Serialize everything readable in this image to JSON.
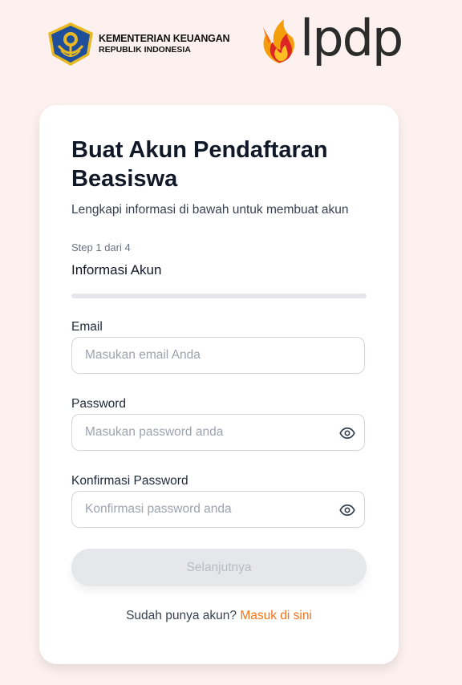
{
  "logos": {
    "kemenkeu_line1": "KEMENTERIAN KEUANGAN",
    "kemenkeu_line2": "REPUBLIK INDONESIA",
    "lpdp_word": "lpdp"
  },
  "form": {
    "title": "Buat Akun Pendaftaran Beasiswa",
    "subtitle": "Lengkapi informasi di bawah untuk membuat akun",
    "step_text": "Step 1 dari 4",
    "step_name": "Informasi Akun",
    "progress": 0,
    "email": {
      "label": "Email",
      "placeholder": "Masukan email Anda",
      "value": ""
    },
    "password": {
      "label": "Password",
      "placeholder": "Masukan password anda",
      "value": ""
    },
    "confirm": {
      "label": "Konfirmasi Password",
      "placeholder": "Konfirmasi password anda",
      "value": ""
    },
    "next_label": "Selanjutnya",
    "login_prompt": "Sudah punya akun?",
    "login_link": "Masuk di sini"
  },
  "colors": {
    "accent": "#f97316",
    "background": "#fdf1ef",
    "button_disabled": "#e5e7eb"
  },
  "icons": [
    "kemenkeu-emblem-icon",
    "lpdp-flame-icon",
    "eye-icon"
  ]
}
